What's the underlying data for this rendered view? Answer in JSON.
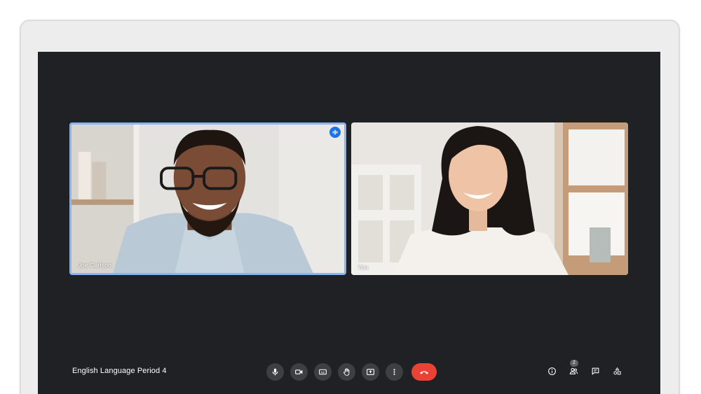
{
  "meeting": {
    "title": "English Language Period 4"
  },
  "participants": [
    {
      "name": "Joe Carlson",
      "speaking": true
    },
    {
      "name": "You",
      "speaking": false
    }
  ],
  "controls": {
    "items": [
      "mic-icon",
      "camera-icon",
      "captions-icon",
      "raise-hand-icon",
      "present-screen-icon",
      "more-options-icon"
    ],
    "hangup": "hangup-icon"
  },
  "side_controls": {
    "people_count": "2",
    "items": [
      "info-icon",
      "people-icon",
      "chat-icon",
      "activities-icon"
    ]
  },
  "colors": {
    "screen_bg": "#202124",
    "button_bg": "#3c4043",
    "hangup": "#ea4335",
    "active_speaker_border": "#8ab4f8",
    "speaking_indicator": "#1a73e8"
  }
}
